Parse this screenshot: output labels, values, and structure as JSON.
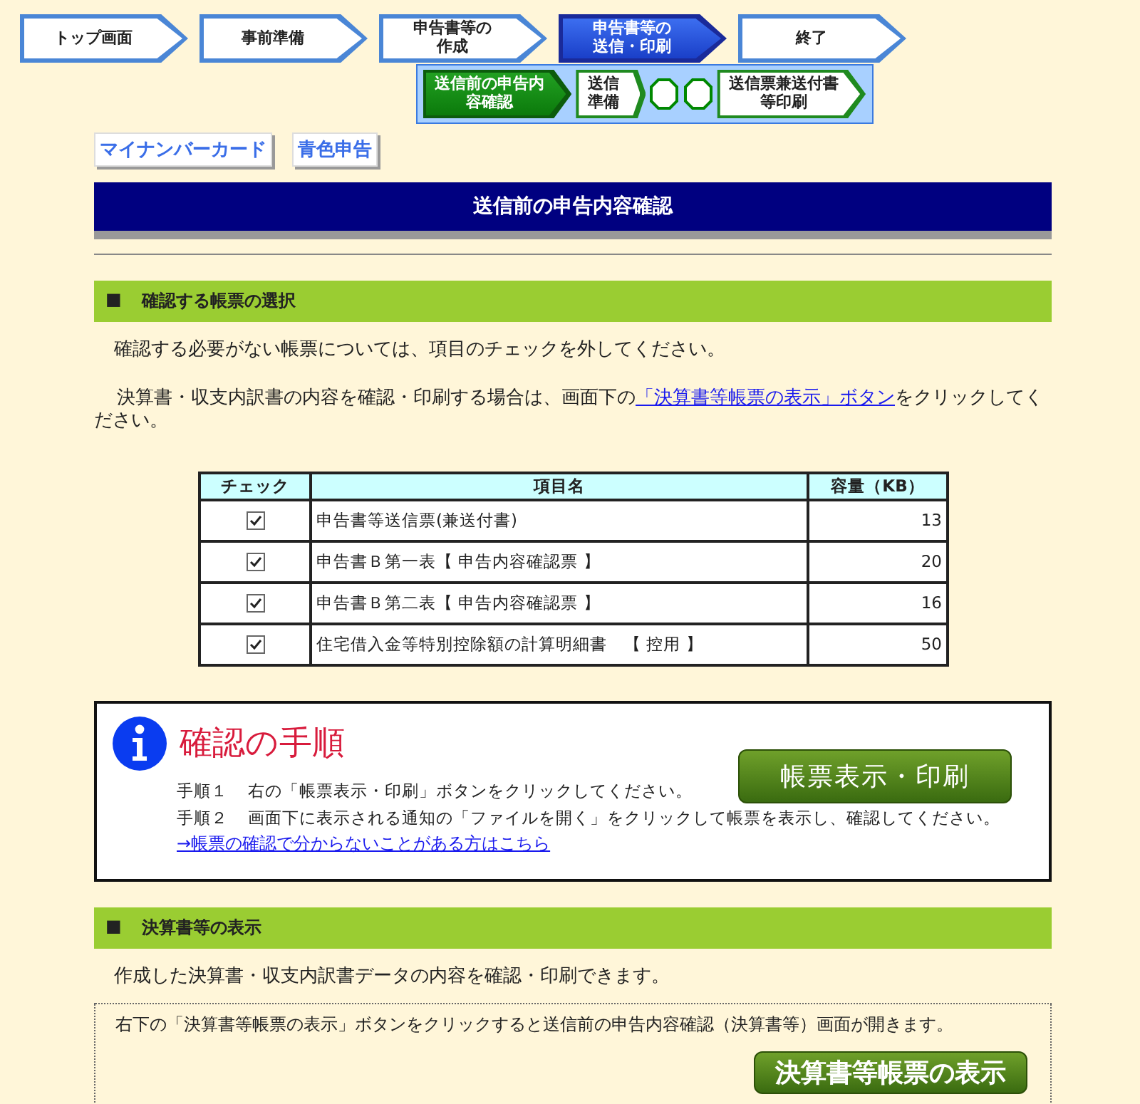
{
  "steps": [
    {
      "label": "トップ画面",
      "selected": false
    },
    {
      "label": "事前準備",
      "selected": false
    },
    {
      "label": "申告書等の作成",
      "selected": false
    },
    {
      "label": "申告書等の送信・印刷",
      "selected": true
    },
    {
      "label": "終了",
      "selected": false
    }
  ],
  "substeps": [
    {
      "kind": "step",
      "label": "送信前の申告内容確認",
      "selected": true
    },
    {
      "kind": "step",
      "label": "送信準備",
      "selected": false
    },
    {
      "kind": "dots"
    },
    {
      "kind": "step",
      "label": "送信票兼送付書等印刷",
      "selected": false
    }
  ],
  "tags": [
    "マイナンバーカード",
    "青色申告"
  ],
  "title": "送信前の申告内容確認",
  "section1": {
    "marker": "■",
    "heading": "確認する帳票の選択",
    "note": "確認する必要がない帳票については、項目のチェックを外してください。",
    "instruction": {
      "before": "決算書・収支内訳書の内容を確認・印刷する場合は、画面下の",
      "link": "「決算書等帳票の表示」ボタン",
      "after": "をクリックしてください。"
    }
  },
  "table": {
    "columns": [
      "チェック",
      "項目名",
      "容量（KB）"
    ],
    "rows": [
      {
        "checked": true,
        "name": "申告書等送信票(兼送付書)",
        "size": "13"
      },
      {
        "checked": true,
        "name": "申告書Ｂ第一表【 申告内容確認票 】",
        "size": "20"
      },
      {
        "checked": true,
        "name": "申告書Ｂ第二表【 申告内容確認票 】",
        "size": "16"
      },
      {
        "checked": true,
        "name": "住宅借入金等特別控除額の計算明細書　【 控用 】",
        "size": "50"
      }
    ]
  },
  "procedure": {
    "title": "確認の手順",
    "steps": [
      {
        "label": "手順１",
        "text": "右の「帳票表示・印刷」ボタンをクリックしてください。"
      },
      {
        "label": "手順２",
        "text": "画面下に表示される通知の「ファイルを開く」をクリックして帳票を表示し、確認してください。"
      }
    ],
    "button": "帳票表示・印刷",
    "link": "→帳票の確認で分からないことがある方はこちら"
  },
  "section2": {
    "marker": "■",
    "heading": "決算書等の表示",
    "text": "作成した決算書・収支内訳書データの内容を確認・印刷できます。",
    "box_text": "右下の「決算書等帳票の表示」ボタンをクリックすると送信前の申告内容確認（決算書等）画面が開きます。",
    "button": "決算書等帳票の表示"
  }
}
